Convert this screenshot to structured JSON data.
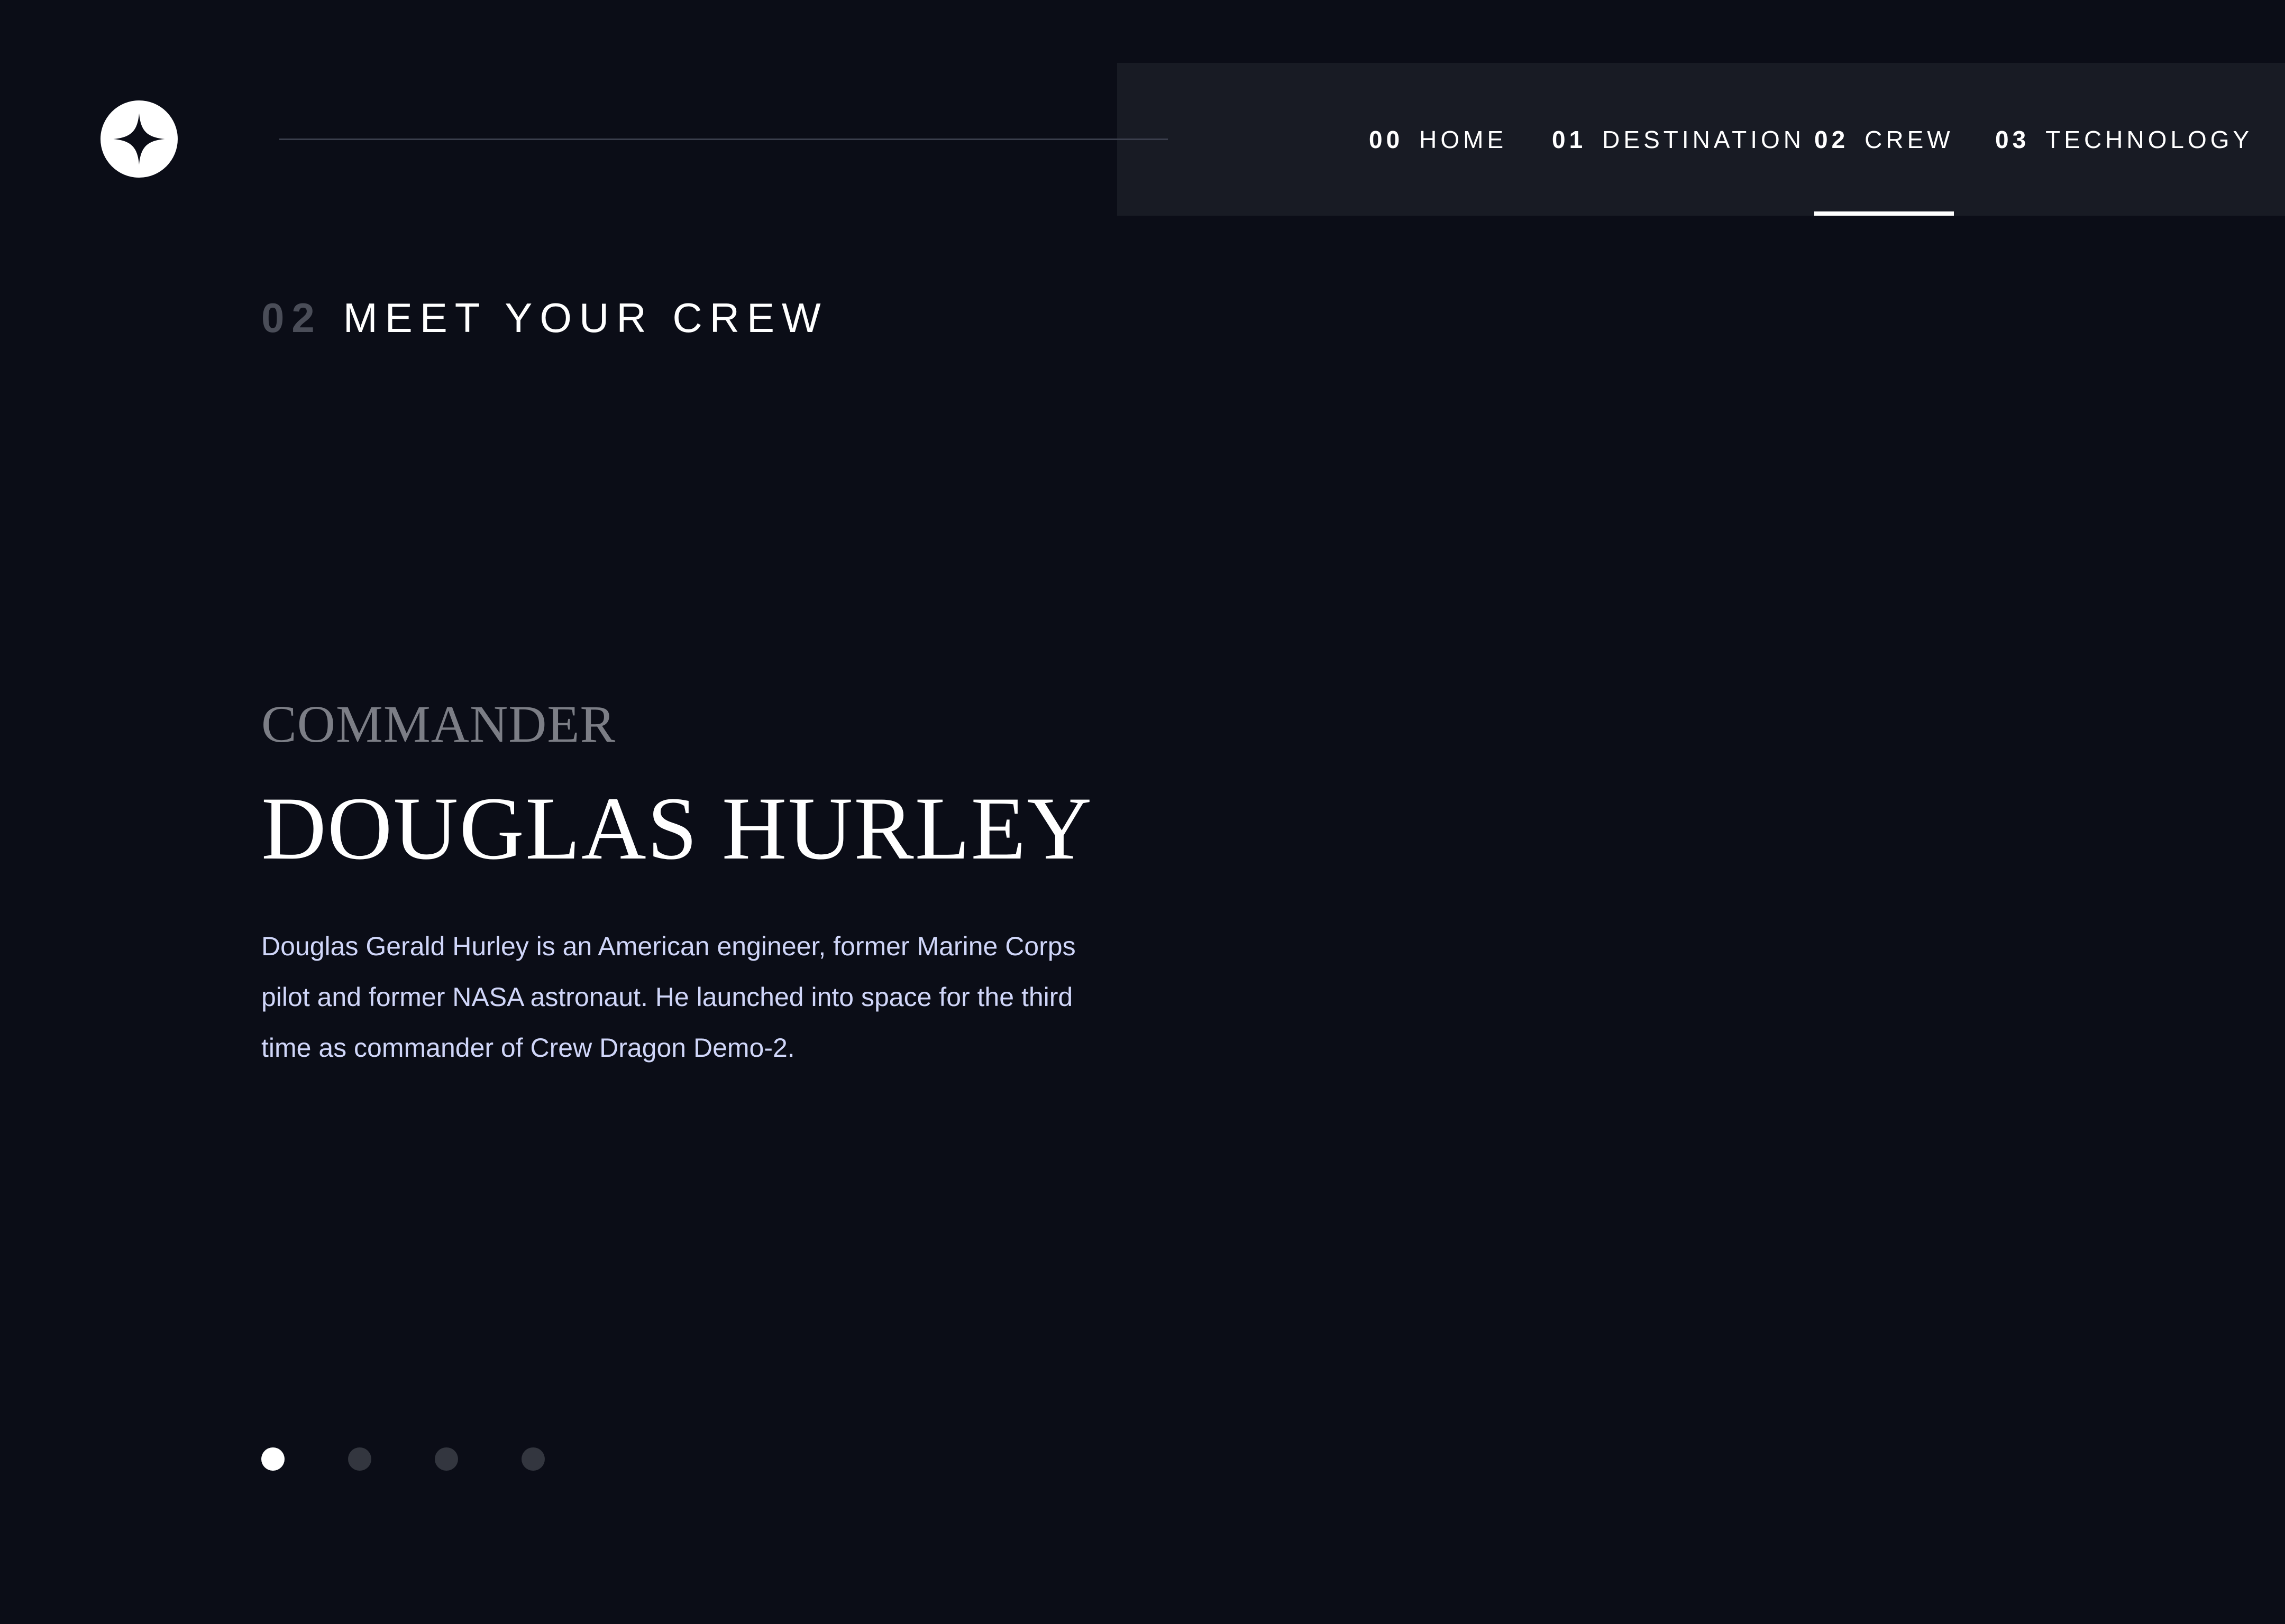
{
  "header": {
    "logo_icon": "star-logo-icon",
    "nav": [
      {
        "num": "00",
        "label": "HOME"
      },
      {
        "num": "01",
        "label": "DESTINATION"
      },
      {
        "num": "02",
        "label": "CREW",
        "active": true
      },
      {
        "num": "03",
        "label": "TECHNOLOGY"
      }
    ]
  },
  "page": {
    "number": "02",
    "title": "MEET YOUR CREW"
  },
  "crew": {
    "role": "COMMANDER",
    "name": "DOUGLAS HURLEY",
    "bio_lines": [
      "Douglas Gerald Hurley is an American engineer, former Marine Corps",
      "pilot and former NASA astronaut. He launched into space for the third",
      "time as commander of Crew Dragon Demo-2."
    ]
  },
  "pager": {
    "count": 4,
    "active_index": 0
  },
  "colors": {
    "background": "#0b0d17",
    "nav_background": "#181b24",
    "accent": "#ffffff",
    "muted": "#7c7e86",
    "body_text": "#d0d6f9"
  }
}
